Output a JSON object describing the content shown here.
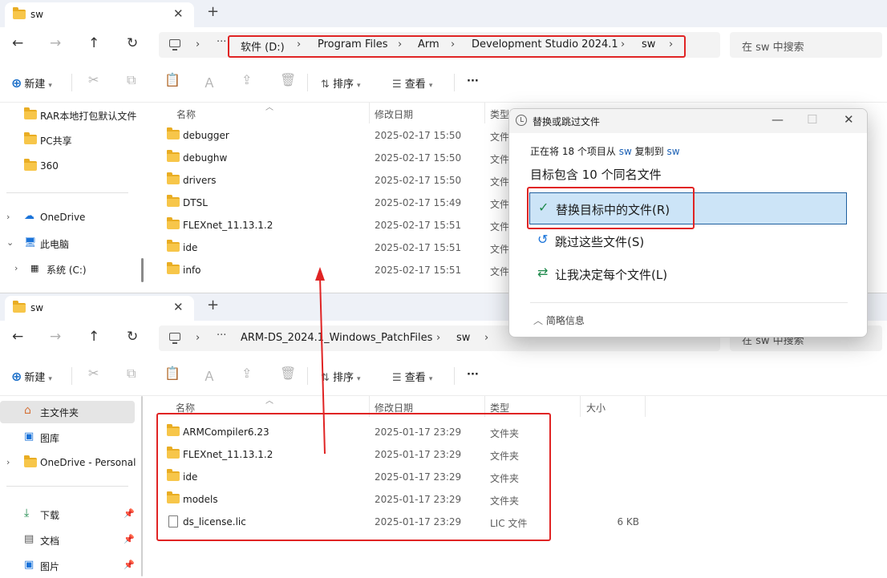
{
  "top": {
    "tab": {
      "title": "sw",
      "close": "✕",
      "new": "+"
    },
    "breadcrumb": [
      "软件 (D:)",
      "Program Files",
      "Arm",
      "Development Studio 2024.1",
      "sw"
    ],
    "search_placeholder": "在 sw 中搜索",
    "toolbar": {
      "new": "新建",
      "sort": "排序",
      "view": "查看",
      "more": "···"
    },
    "sidebar": [
      {
        "label": "RAR本地打包默认文件"
      },
      {
        "label": "PC共享"
      },
      {
        "label": "360"
      },
      {
        "label": "OneDrive"
      },
      {
        "label": "此电脑"
      },
      {
        "label": "系统 (C:)"
      }
    ],
    "columns": {
      "name": "名称",
      "date": "修改日期",
      "type": "类型"
    },
    "rows": [
      {
        "name": "debugger",
        "date": "2025-02-17 15:50",
        "type": "文件"
      },
      {
        "name": "debughw",
        "date": "2025-02-17 15:50",
        "type": "文件"
      },
      {
        "name": "drivers",
        "date": "2025-02-17 15:50",
        "type": "文件"
      },
      {
        "name": "DTSL",
        "date": "2025-02-17 15:49",
        "type": "文件"
      },
      {
        "name": "FLEXnet_11.13.1.2",
        "date": "2025-02-17 15:51",
        "type": "文件"
      },
      {
        "name": "ide",
        "date": "2025-02-17 15:51",
        "type": "文件"
      },
      {
        "name": "info",
        "date": "2025-02-17 15:51",
        "type": "文件"
      }
    ]
  },
  "bottom": {
    "tab": {
      "title": "sw",
      "close": "✕",
      "new": "+"
    },
    "breadcrumb": [
      "ARM-DS_2024.1_Windows_PatchFiles",
      "sw"
    ],
    "search_placeholder": "在 sw 中搜索",
    "toolbar": {
      "new": "新建",
      "sort": "排序",
      "view": "查看",
      "more": "···"
    },
    "sidebar": [
      {
        "label": "主文件夹"
      },
      {
        "label": "图库"
      },
      {
        "label": "OneDrive - Personal"
      },
      {
        "label": "下载"
      },
      {
        "label": "文档"
      },
      {
        "label": "图片"
      }
    ],
    "columns": {
      "name": "名称",
      "date": "修改日期",
      "type": "类型",
      "size": "大小"
    },
    "rows": [
      {
        "name": "ARMCompiler6.23",
        "date": "2025-01-17 23:29",
        "type": "文件夹",
        "size": ""
      },
      {
        "name": "FLEXnet_11.13.1.2",
        "date": "2025-01-17 23:29",
        "type": "文件夹",
        "size": ""
      },
      {
        "name": "ide",
        "date": "2025-01-17 23:29",
        "type": "文件夹",
        "size": ""
      },
      {
        "name": "models",
        "date": "2025-01-17 23:29",
        "type": "文件夹",
        "size": ""
      },
      {
        "name": "ds_license.lic",
        "date": "2025-01-17 23:29",
        "type": "LIC 文件",
        "size": "6 KB"
      }
    ]
  },
  "dialog": {
    "title": "替换或跳过文件",
    "progress_prefix": "正在将 18 个项目从",
    "source": "sw",
    "copy_to": "复制到",
    "dest": "sw",
    "headline": "目标包含 10 个同名文件",
    "options": [
      "替换目标中的文件(R)",
      "跳过这些文件(S)",
      "让我决定每个文件(L)"
    ],
    "more_info": "简略信息"
  },
  "colors": {
    "annotation_red": "#e02424",
    "highlight": "#cce4f7",
    "accent": "#1a5fb4"
  }
}
